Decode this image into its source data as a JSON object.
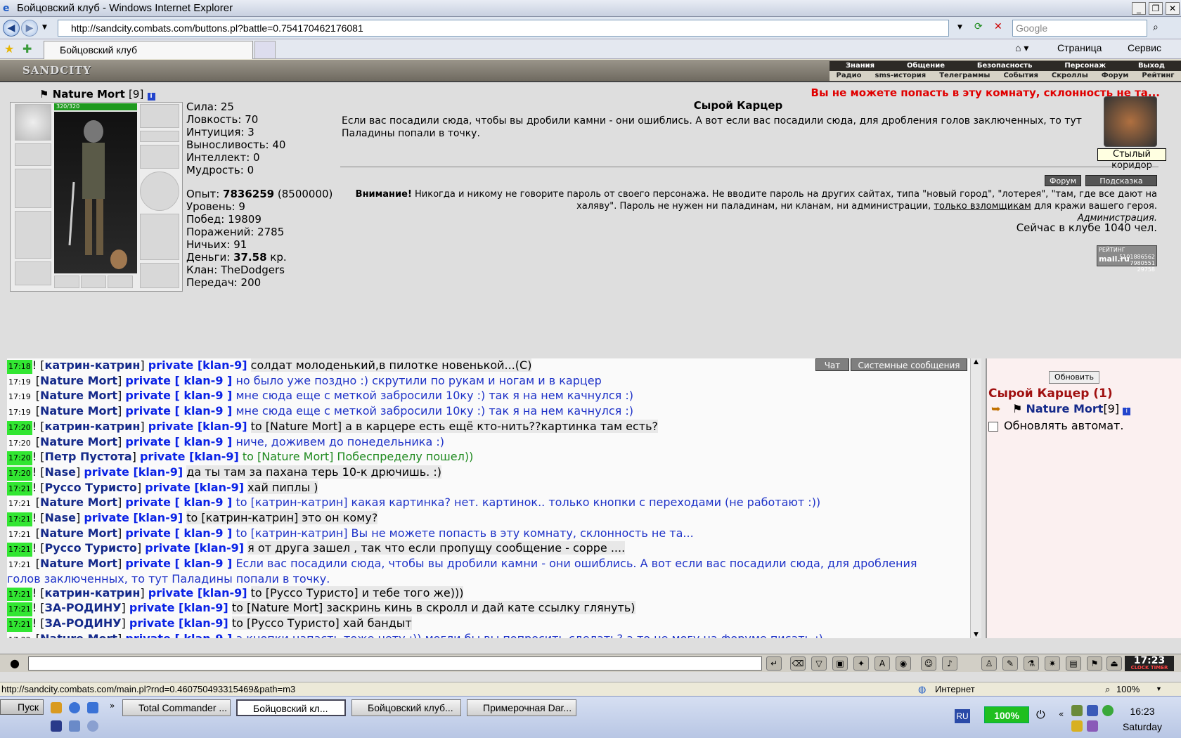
{
  "window": {
    "title": "Бойцовский клуб - Windows Internet Explorer"
  },
  "address": {
    "url": "http://sandcity.combats.com/buttons.pl?battle=0.754170462176081",
    "search_placeholder": "Google"
  },
  "tabs": {
    "active": "Бойцовский клуб",
    "page_menu": "Страница",
    "tools_menu": "Сервис"
  },
  "site": {
    "logo": "SANDCITY",
    "menu_top": [
      "Знания",
      "Общение",
      "Безопасность",
      "Персонаж",
      "Выход"
    ],
    "menu_bottom": [
      "Радио",
      "sms-история",
      "Телеграммы",
      "События",
      "Скроллы",
      "Форум",
      "Рейтинг"
    ]
  },
  "character": {
    "name": "Nature Mort",
    "level": "[9]",
    "hp": "320/320",
    "stats": [
      [
        "Сила:",
        "25"
      ],
      [
        "Ловкость:",
        "70"
      ],
      [
        "Интуиция:",
        "3"
      ],
      [
        "Выносливость:",
        "40"
      ],
      [
        "Интеллект:",
        "0"
      ],
      [
        "Мудрость:",
        "0"
      ]
    ],
    "exp_label": "Опыт:",
    "exp_value": "7836259",
    "exp_next": "(8500000)",
    "info": [
      [
        "Уровень:",
        "9"
      ],
      [
        "Побед:",
        "19809"
      ],
      [
        "Поражений:",
        "2785"
      ],
      [
        "Ничьих:",
        "91"
      ]
    ],
    "money_label": "Деньги:",
    "money_value": "37.58",
    "money_unit": "кр.",
    "clan_label": "Клан:",
    "clan_value": "TheDodgers",
    "transfers_label": "Передач:",
    "transfers_value": "200"
  },
  "room": {
    "title": "Сырой Карцер",
    "description": "Если вас посадили сюда, чтобы вы дробили камни - они ошиблись. А вот если вас посадили сюда, для дробления голов заключенных, то тут Паладины попали в точку.",
    "error": "Вы не можете попасть в эту комнату, склонность не та...",
    "exit_tooltip": "Стылый коридор",
    "forum_btn": "Форум",
    "hint_btn": "Подсказка",
    "warning_bold": "Внимание!",
    "warning_text": " Никогда и никому не говорите пароль от своего персонажа. Не вводите пароль на других сайтах, типа \"новый город\", \"лотерея\", \"там, где все дают на халяву\". Пароль не нужен ни паладинам, ни кланам, ни администрации, ",
    "warning_link": "только взломщикам",
    "warning_end": " для кражи вашего героя.",
    "admin": "Администрация.",
    "online": "Сейчас в клубе 1040 чел.",
    "counter_top": "РЕЙТИНГ",
    "counter_num1": "5101886562",
    "counter_num2": "7980551",
    "counter_num3": "29758",
    "counter_brand": "mail.ru"
  },
  "chat": {
    "tabs": [
      "Чат",
      "Системные сообщения"
    ],
    "lines": [
      {
        "t": "17:18",
        "g": true,
        "n": "катрин-катрин",
        "p": "private [klan-9]",
        "m": "солдат молоденький,в пилотке новенькой...(C)",
        "c": "k",
        "h": true
      },
      {
        "t": "17:19",
        "g": false,
        "n": "Nature Mort",
        "p": "private [ klan-9 ]",
        "m": "но было уже поздно :) скрутили по рукам и ногам и в карцер",
        "c": "b"
      },
      {
        "t": "17:19",
        "g": false,
        "n": "Nature Mort",
        "p": "private [ klan-9 ]",
        "m": "мне сюда еще с меткой забросили 10ку :) так я на нем качнулся :)",
        "c": "b"
      },
      {
        "t": "17:19",
        "g": false,
        "n": "Nature Mort",
        "p": "private [ klan-9 ]",
        "m": "мне сюда еще с меткой забросили 10ку :) так я на нем качнулся :)",
        "c": "b"
      },
      {
        "t": "17:20",
        "g": true,
        "n": "катрин-катрин",
        "p": "private [klan-9]",
        "m": "to [Nature Mort] а в карцере есть ещё кто-нить??картинка там есть?",
        "c": "k",
        "h": true
      },
      {
        "t": "17:20",
        "g": false,
        "n": "Nature Mort",
        "p": "private [ klan-9 ]",
        "m": "ниче, доживем до понедельника :)",
        "c": "b"
      },
      {
        "t": "17:20",
        "g": true,
        "n": "Петр Пустота",
        "p": "private [klan-9]",
        "m": "to [Nature Mort] Побеспределу пошел))",
        "c": "gr"
      },
      {
        "t": "17:20",
        "g": true,
        "n": "Nase",
        "p": "private [klan-9]",
        "m": "да ты там за пахана терь 10-к дрючишь. :)",
        "c": "k",
        "h": true
      },
      {
        "t": "17:21",
        "g": true,
        "n": "Руссо Туристо",
        "p": "private [klan-9]",
        "m": "хай пиплы )",
        "c": "k",
        "h": true
      },
      {
        "t": "17:21",
        "g": false,
        "n": "Nature Mort",
        "p": "private [ klan-9 ]",
        "m": "to [катрин-катрин] какая картинка? нет. картинок.. только кнопки с переходами (не работают :))",
        "c": "b"
      },
      {
        "t": "17:21",
        "g": true,
        "n": "Nase",
        "p": "private [klan-9]",
        "m": "to [катрин-катрин] это он кому?",
        "c": "k",
        "h": true
      },
      {
        "t": "17:21",
        "g": false,
        "n": "Nature Mort",
        "p": "private [ klan-9 ]",
        "m": "to [катрин-катрин] Вы не можете попасть в эту комнату, склонность не та...",
        "c": "b"
      },
      {
        "t": "17:21",
        "g": true,
        "n": "Руссо Туристо",
        "p": "private [klan-9]",
        "m": "я от друга зашел , так что если пропущу сообщение - сорре ....",
        "c": "k",
        "h": true
      },
      {
        "t": "17:21",
        "g": false,
        "n": "Nature Mort",
        "p": "private [ klan-9 ]",
        "m": "Если вас посадили сюда, чтобы вы дробили камни - они ошиблись. А вот если вас посадили сюда, для дробления голов заключенных, то тут Паладины попали в точку.",
        "c": "b",
        "w": true
      },
      {
        "t": "17:21",
        "g": true,
        "n": "катрин-катрин",
        "p": "private [klan-9]",
        "m": "to [Руссо Туристо] и тебе того же)))",
        "c": "k",
        "h": true
      },
      {
        "t": "17:21",
        "g": true,
        "n": "ЗА-РОДИНУ",
        "p": "private [klan-9]",
        "m": "to [Nature Mort] заскринь кинь в скролл и дай кате ссылку глянуть)",
        "c": "k",
        "h": true
      },
      {
        "t": "17:21",
        "g": true,
        "n": "ЗА-РОДИНУ",
        "p": "private [klan-9]",
        "m": "to [Руссо Туристо] хай бандыт",
        "c": "k",
        "h": true
      },
      {
        "t": "17:22",
        "g": false,
        "n": "Nature Mort",
        "p": "private [ klan-9 ]",
        "m": "а кнопки напасть тоже нету :)) могли бы вы попросить сделать? а то не могу на форуме писать :)",
        "c": "b"
      }
    ]
  },
  "side": {
    "refresh": "Обновить",
    "room_title": "Сырой Карцер (1)",
    "user": "Nature Mort",
    "user_level": "[9]",
    "auto_label": "Обновлять автомат."
  },
  "inputbar": {
    "clock": "17:23",
    "clock_label": "CLOCK TIMER"
  },
  "statusbar": {
    "url": "http://sandcity.combats.com/main.pl?rnd=0.460750493315469&path=m3",
    "zone": "Интернет",
    "zoom": "100%"
  },
  "taskbar": {
    "start": "Пуск",
    "tasks": [
      "Total Commander ...",
      "Бойцовский кл...",
      "Бойцовский клуб...",
      "Примерочная Dar..."
    ],
    "lang": "RU",
    "battery": "100%",
    "time": "16:23",
    "day": "Saturday"
  }
}
